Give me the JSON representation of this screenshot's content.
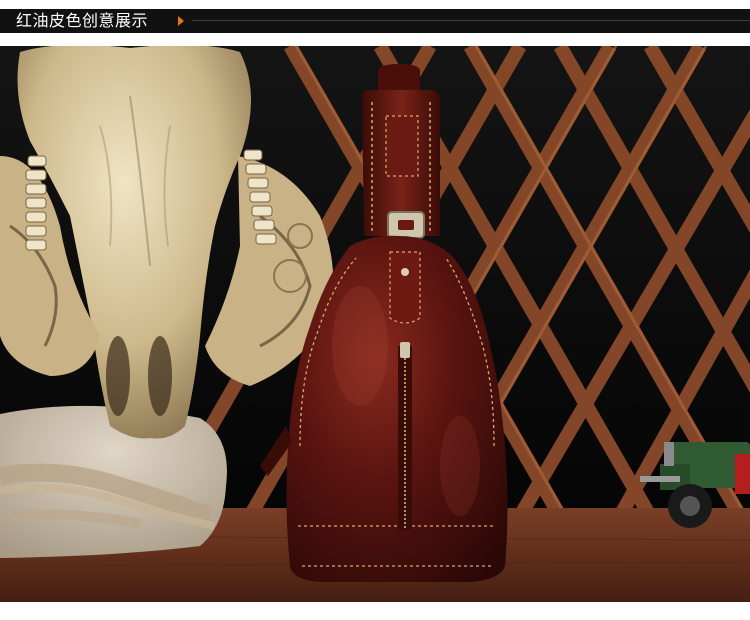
{
  "header": {
    "title": "红油皮色创意展示",
    "accent_color": "#e8731f",
    "bar_color": "#111111"
  },
  "photo": {
    "subject": "chest-sling-bag",
    "colors": {
      "leather": "#5a1410",
      "wall": "#0d0d0d",
      "lattice": "#8a4a2a",
      "table": "#6b3522",
      "skull": "#d8c7a0",
      "burlap": "#cbbfae"
    }
  }
}
